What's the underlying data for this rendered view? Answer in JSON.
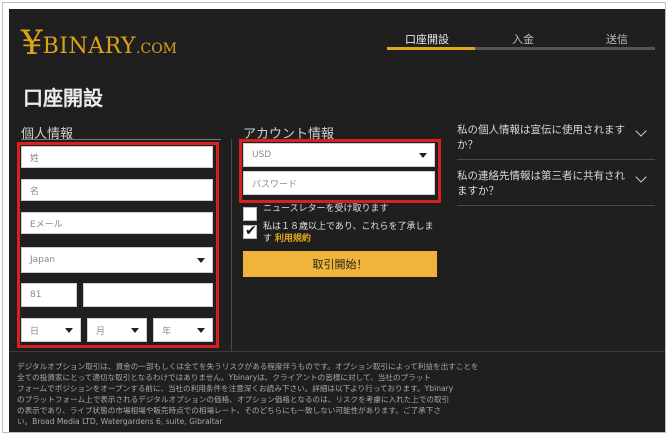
{
  "logo": {
    "mark": "¥",
    "word": "BINARY",
    "suffix": ".COM"
  },
  "steps": [
    "口座開設",
    "入金",
    "送信"
  ],
  "page_title": "口座開設",
  "personal": {
    "title": "個人情報",
    "last_name_placeholder": "姓",
    "first_name_placeholder": "名",
    "email_placeholder": "Eメール",
    "country": "Japan",
    "phone_code": "81",
    "phone_placeholder": "",
    "dob_day": "日",
    "dob_month": "月",
    "dob_year": "年"
  },
  "account": {
    "title": "アカウント情報",
    "currency": "USD",
    "password_placeholder": "パスワード",
    "newsletter_label": "ニュースレターを受け取ります",
    "age_text": "私は１８歳以上であり、これらを了承します",
    "terms_link": "利用規約",
    "newsletter_checked": false,
    "age_checked": true,
    "submit_label": "取引開始！"
  },
  "faq": [
    "私の個人情報は宣伝に使用されますか？",
    "私の連絡先情報は第三者に共有されますか？"
  ],
  "disclaimer": "デジタルオプション取引は、資金の一部もしくは全てを失うリスクがある程度伴うものです。オプション取引によって利益を出すことを\n全ての投資家にとって適切な取引となるわけではありません。Ybinaryは、クライアントの皆様に対して、当社のプラット\nフォームでポジションをオープンする前に、当社の利用条件を注意深くお読み下さい。詳細は以下より行っております。Ybinary\nのプラットフォーム上で表示されるデジタルオプションの価格、オプション価格となるのは、リスクを考慮に入れた上での取引\nの表示であり、ライブ状態の市場相場や販売時点での相場レート、そのどちらにも一致しない可能性があります。ご了承下さ\nい。Broad Media LTD, Watergardens 6, suite, Gibraltar",
  "colors": {
    "accent": "#e0a81e",
    "highlight": "#d8201f",
    "background": "#1f1f1f"
  }
}
